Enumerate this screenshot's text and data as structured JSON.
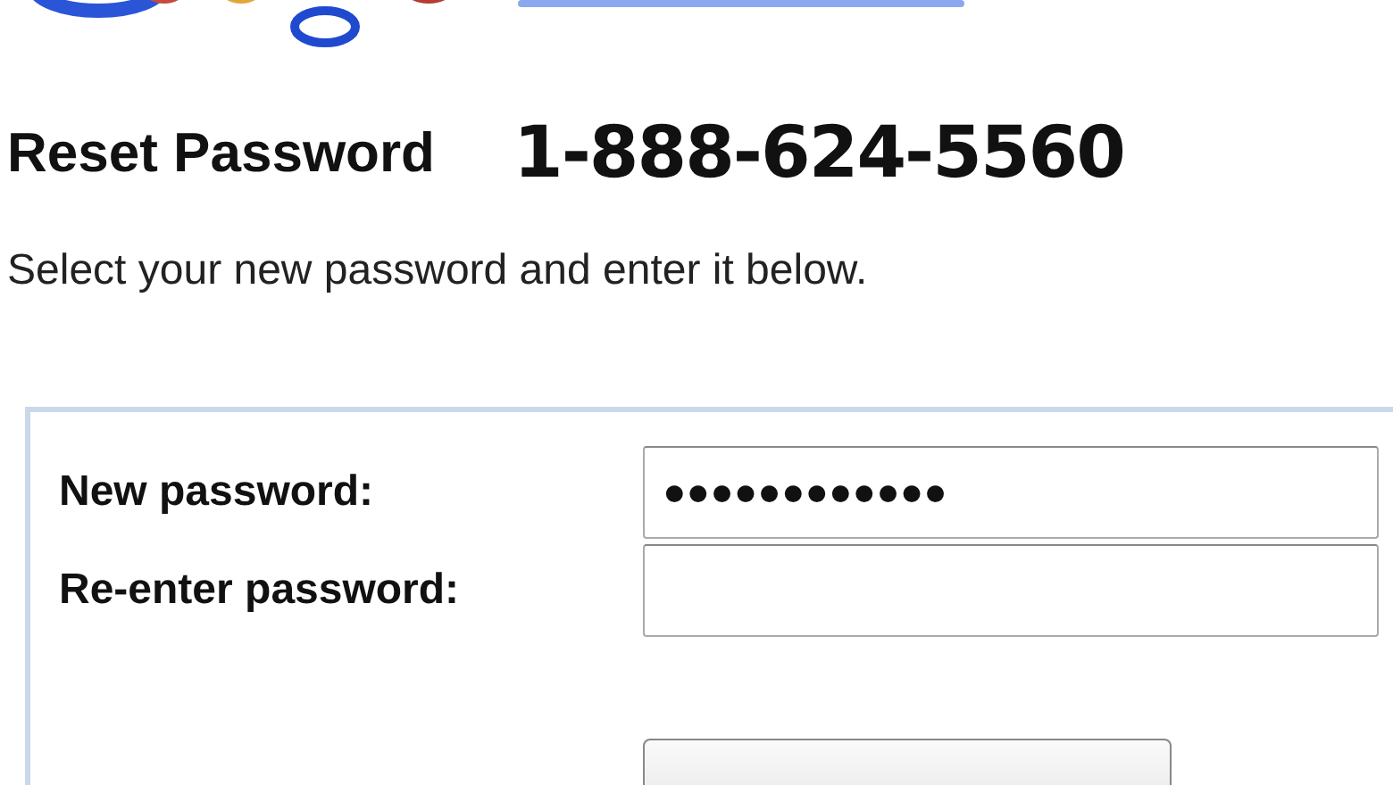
{
  "heading": "Reset Password",
  "phone": "1-888-624-5560",
  "instruction": "Select your new password and enter it below.",
  "fields": [
    {
      "label": "New password:",
      "value": "●●●●●●●●●●●●"
    },
    {
      "label": "Re-enter password:"
    }
  ]
}
